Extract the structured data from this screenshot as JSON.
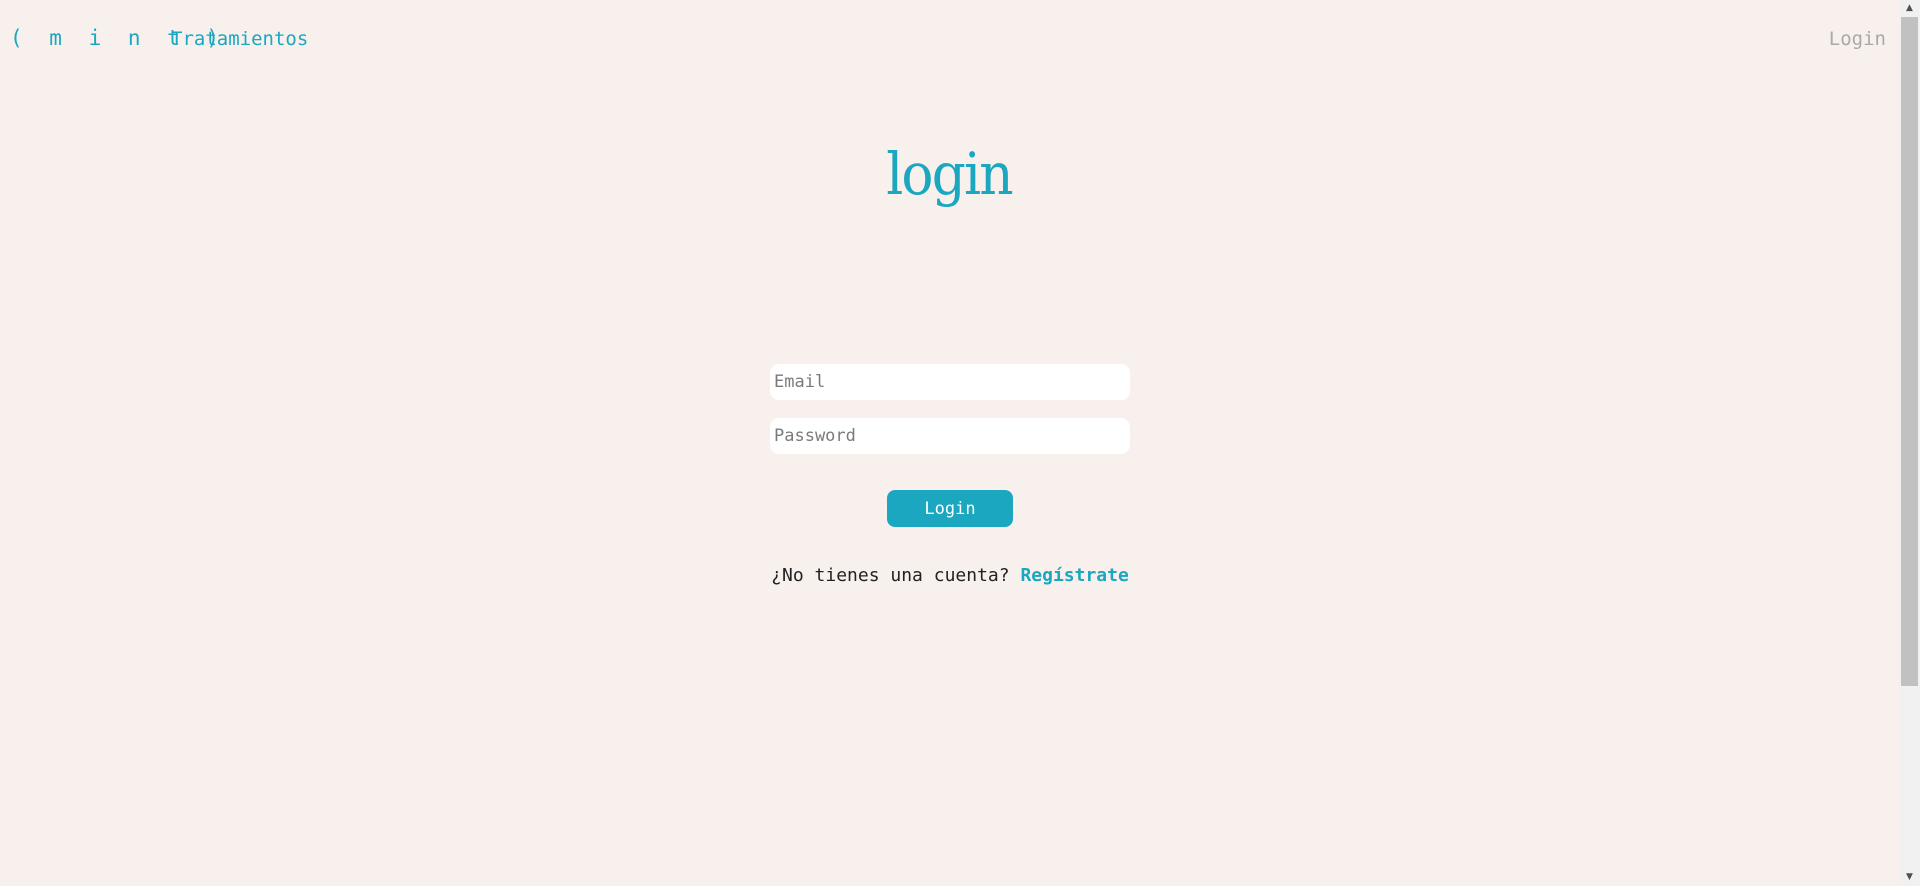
{
  "nav": {
    "brand": "( m i n t )",
    "treatments_label": "Tratamientos",
    "login_label": "Login"
  },
  "main": {
    "title": "login",
    "email_placeholder": "Email",
    "password_placeholder": "Password",
    "submit_label": "Login",
    "signup_prompt": "¿No tienes una cuenta?",
    "signup_link": "Regístrate"
  },
  "colors": {
    "background": "#f8f0ed",
    "accent": "#1aa7bf",
    "muted": "#a9a9a9"
  },
  "icons": {
    "scroll_up": "chevron-up-icon",
    "scroll_down": "chevron-down-icon"
  }
}
